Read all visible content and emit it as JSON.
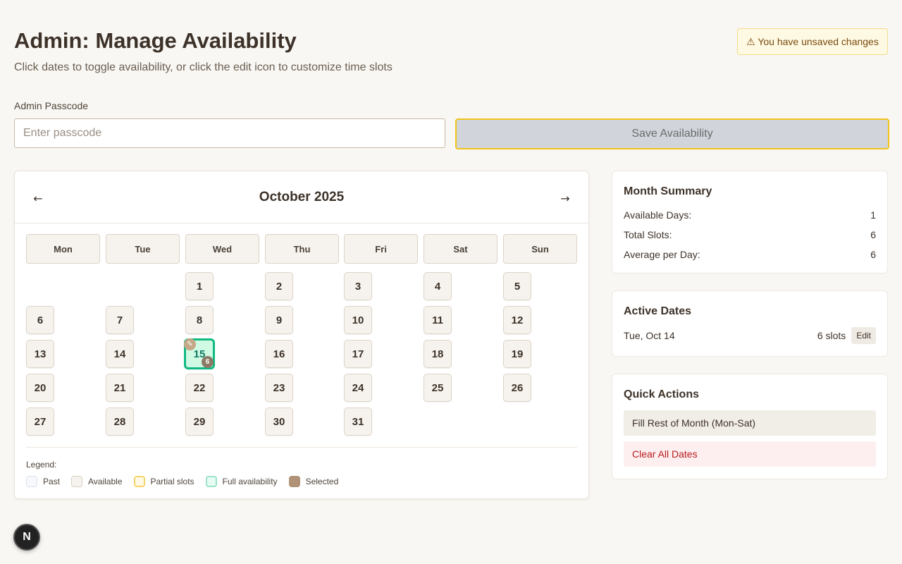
{
  "header": {
    "title": "Admin: Manage Availability",
    "subtitle": "Click dates to toggle availability, or click the edit icon to customize time slots",
    "unsaved_warning": "⚠ You have unsaved changes"
  },
  "passcode": {
    "label": "Admin Passcode",
    "placeholder": "Enter passcode",
    "value": ""
  },
  "save_button": {
    "label": "Save Availability",
    "disabled": true
  },
  "calendar": {
    "month_label": "October 2025",
    "prev_label": "←",
    "next_label": "→",
    "weekdays": [
      "Mon",
      "Tue",
      "Wed",
      "Thu",
      "Fri",
      "Sat",
      "Sun"
    ],
    "first_day_column": 2,
    "days_in_month": 31,
    "full_availability_day": 15,
    "full_day_slots": "6",
    "edit_icon": "✎",
    "legend_title": "Legend:",
    "legend": [
      {
        "key": "past",
        "label": "Past"
      },
      {
        "key": "available",
        "label": "Available"
      },
      {
        "key": "partial",
        "label": "Partial slots"
      },
      {
        "key": "full",
        "label": "Full availability"
      },
      {
        "key": "selected",
        "label": "Selected"
      }
    ]
  },
  "month_summary": {
    "title": "Month Summary",
    "rows": [
      {
        "label": "Available Days:",
        "value": "1"
      },
      {
        "label": "Total Slots:",
        "value": "6"
      },
      {
        "label": "Average per Day:",
        "value": "6"
      }
    ]
  },
  "active_dates": {
    "title": "Active Dates",
    "items": [
      {
        "date": "Tue, Oct 14",
        "slots": "6 slots",
        "edit_label": "Edit"
      }
    ]
  },
  "quick_actions": {
    "title": "Quick Actions",
    "fill_label": "Fill Rest of Month (Mon-Sat)",
    "clear_label": "Clear All Dates"
  },
  "colors": {
    "background": "#f9f7f3",
    "full_border": "#10b981",
    "full_fill": "#d1fae5",
    "warning_bg": "#fef9e3",
    "danger_text": "#b91c1c"
  },
  "nextjs_badge": "N"
}
